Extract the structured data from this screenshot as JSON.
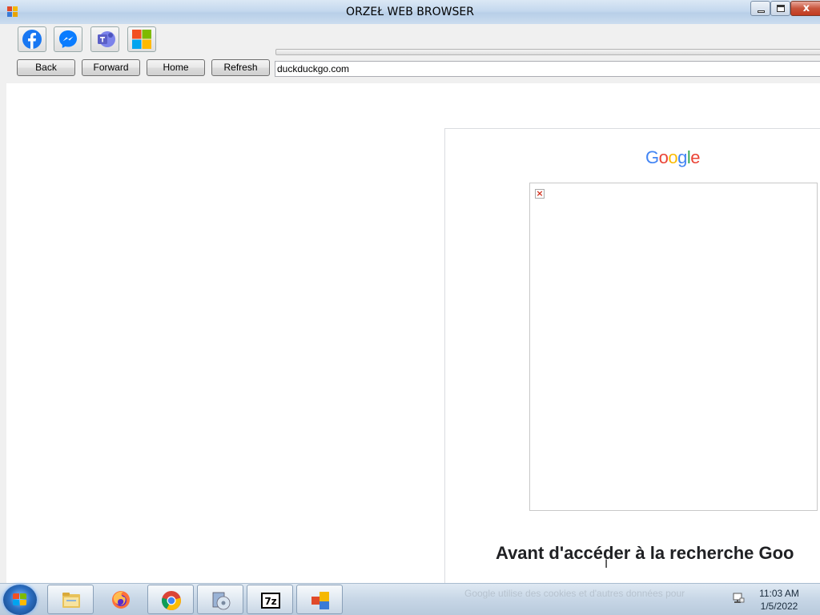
{
  "window": {
    "title": "ORZEŁ WEB BROWSER",
    "close_glyph": "x"
  },
  "quick_launch": [
    {
      "name": "facebook",
      "icon": "facebook-icon"
    },
    {
      "name": "messenger",
      "icon": "messenger-icon"
    },
    {
      "name": "teams",
      "icon": "teams-icon"
    },
    {
      "name": "microsoft",
      "icon": "microsoft-icon"
    }
  ],
  "nav": {
    "back_label": "Back",
    "forward_label": "Forward",
    "home_label": "Home",
    "refresh_label": "Refresh"
  },
  "address_bar": {
    "value": "duckduckgo.com"
  },
  "page": {
    "logo_letters": [
      "G",
      "o",
      "o",
      "g",
      "l",
      "e"
    ],
    "logo_colors": [
      "#4285f4",
      "#ea4335",
      "#fbbc05",
      "#4285f4",
      "#34a853",
      "#ea4335"
    ],
    "broken_image_glyph": "×",
    "heading": "Avant d'accéder à la recherche Goo"
  },
  "taskbar": {
    "items": [
      "start-button",
      "file-explorer",
      "firefox",
      "chrome",
      "media-player",
      "7zip",
      "orzel-browser"
    ],
    "faded_text": "Google utilise des cookies et d'autres données pour",
    "clock_time": "11:03 AM",
    "clock_date": "1/5/2022"
  },
  "colors": {
    "facebook": "#1877f2",
    "messenger": "#0a7cff",
    "teams": "#5b5fc7",
    "ms_red": "#f25022",
    "ms_green": "#7fba00",
    "ms_blue": "#00a4ef",
    "ms_yellow": "#ffb900"
  }
}
